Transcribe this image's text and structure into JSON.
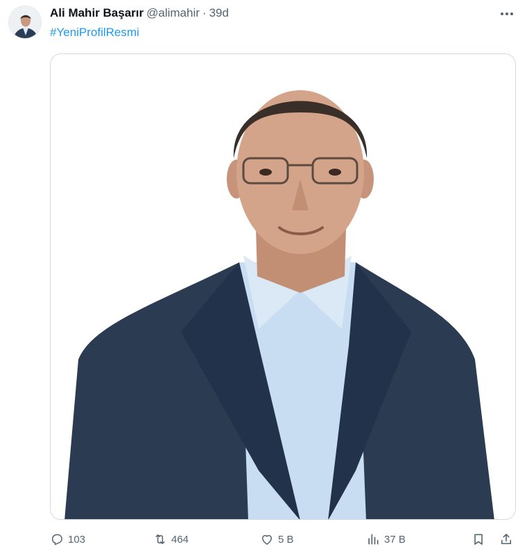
{
  "author": {
    "name": "Ali Mahir Başarır",
    "handle": "@alimahir",
    "separator": "·",
    "time": "39d"
  },
  "tweet": {
    "hashtag": "#YeniProfilResmi"
  },
  "actions": {
    "replies": "103",
    "retweets": "464",
    "likes": "5 B",
    "views": "37 B"
  },
  "icons": {
    "reply": "reply-icon",
    "retweet": "retweet-icon",
    "like": "heart-icon",
    "views": "views-icon",
    "bookmark": "bookmark-icon",
    "share": "share-icon",
    "more": "more-icon"
  },
  "colors": {
    "link": "#1d9bf0",
    "secondary_text": "#536471",
    "border": "#cfd9de",
    "suit": "#2b3c52",
    "shirt": "#c9ddf2"
  }
}
